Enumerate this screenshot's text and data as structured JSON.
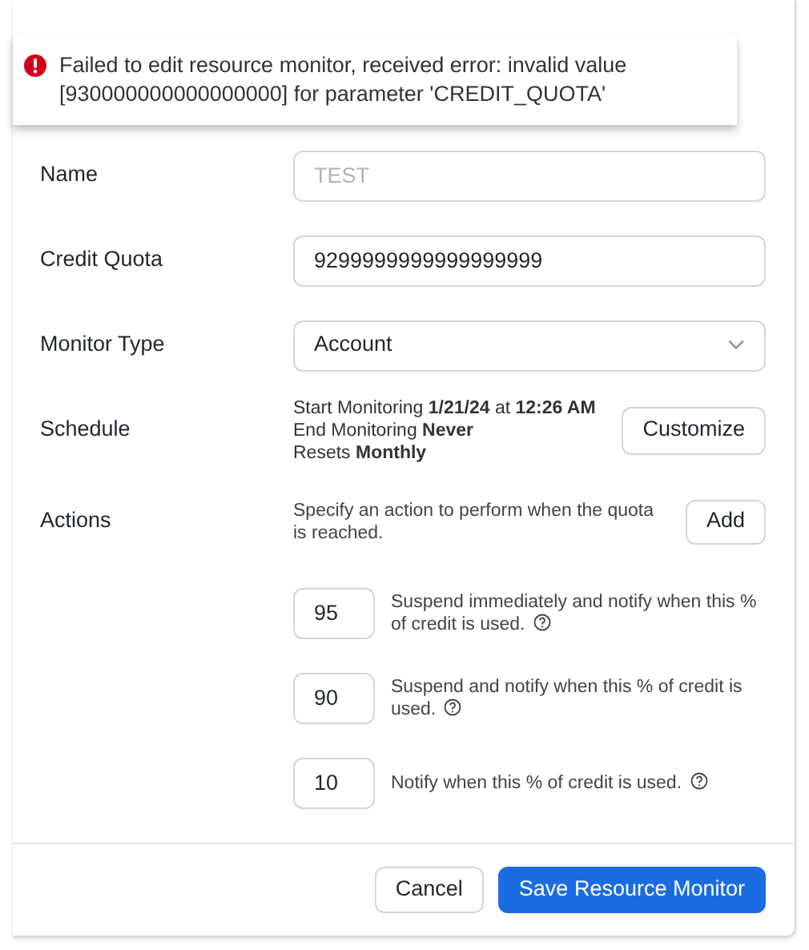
{
  "error_banner": {
    "message": "Failed to edit resource monitor, received error: invalid value [930000000000000000] for parameter 'CREDIT_QUOTA'"
  },
  "fields": [
    {
      "kind": "text",
      "label": "Name",
      "value": "TEST",
      "disabled": true
    },
    {
      "kind": "text",
      "label": "Credit Quota",
      "value": "9299999999999999999",
      "disabled": false
    },
    {
      "kind": "select",
      "label": "Monitor Type",
      "value": "Account"
    }
  ],
  "schedule": {
    "label": "Schedule",
    "lines": [
      "Start Monitoring **1/21/24** at **12:26 AM**",
      "End Monitoring **Never**",
      "Resets **Monthly**"
    ],
    "button": "Customize"
  },
  "actions": {
    "label": "Actions",
    "description": "Specify an action to perform when the quota is reached.",
    "button": "Add",
    "items": [
      {
        "value": "95",
        "text": "Suspend immediately and notify when this % of credit is used."
      },
      {
        "value": "90",
        "text": "Suspend and notify when this % of credit is used."
      },
      {
        "value": "10",
        "text": "Notify when this % of credit is used."
      }
    ]
  },
  "footer": {
    "buttons": [
      {
        "label": "Cancel",
        "kind": "secondary"
      },
      {
        "label": "Save Resource Monitor",
        "kind": "primary"
      }
    ]
  }
}
